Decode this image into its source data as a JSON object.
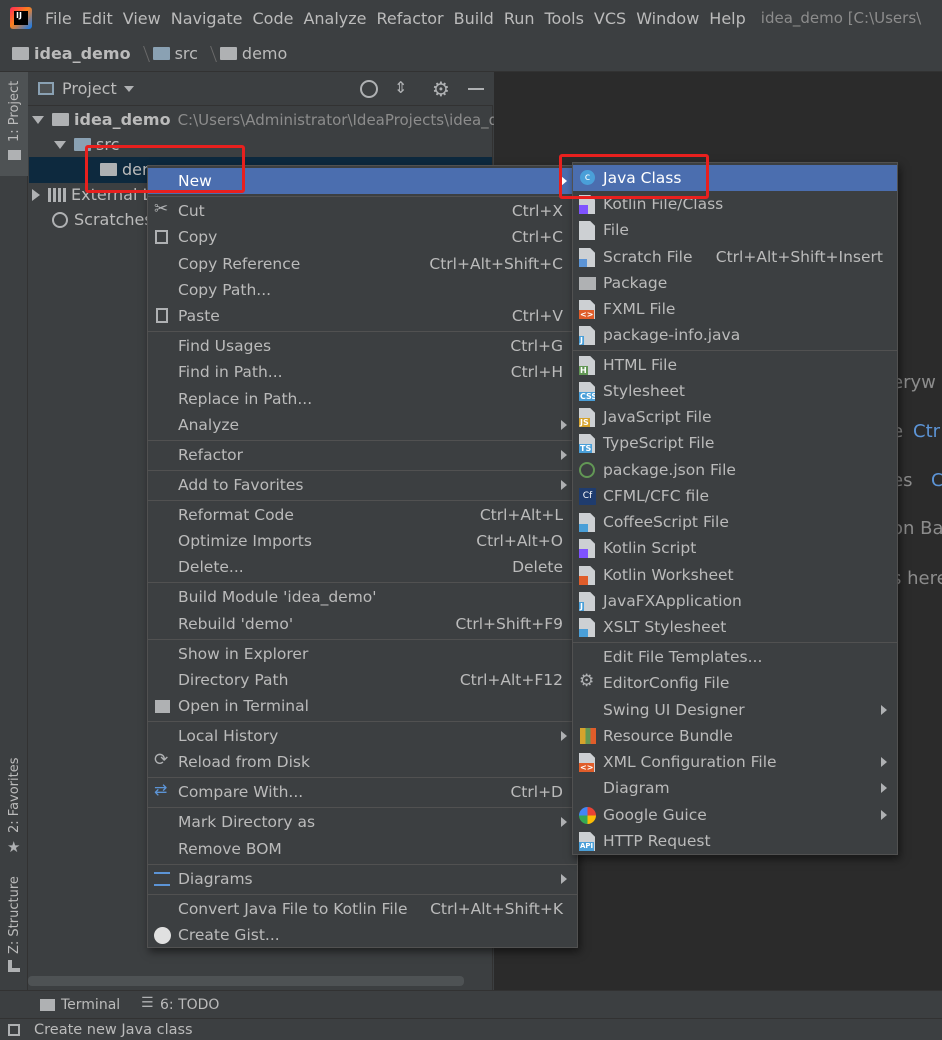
{
  "app": {
    "logo_text": "IJ",
    "window_title": "idea_demo [C:\\Users\\"
  },
  "menubar": [
    "File",
    "Edit",
    "View",
    "Navigate",
    "Code",
    "Analyze",
    "Refactor",
    "Build",
    "Run",
    "Tools",
    "VCS",
    "Window",
    "Help"
  ],
  "breadcrumb": [
    "idea_demo",
    "src",
    "demo"
  ],
  "tool_strip": {
    "project": "1: Project",
    "favorites": "2: Favorites",
    "structure": "Z: Structure"
  },
  "panel": {
    "title": "Project"
  },
  "tree": {
    "root": "idea_demo",
    "root_path": "C:\\Users\\Administrator\\IdeaProjects\\idea_de",
    "src": "src",
    "demo": "dem",
    "external": "External L",
    "scratches": "Scratches"
  },
  "editor_hints": [
    "eryw",
    "e",
    "Ctr",
    "es",
    "C",
    "on Ba",
    "s here"
  ],
  "context_menu": {
    "new": "New",
    "items": [
      {
        "label": "Cut",
        "shortcut": "Ctrl+X"
      },
      {
        "label": "Copy",
        "shortcut": "Ctrl+C"
      },
      {
        "label": "Copy Reference",
        "shortcut": "Ctrl+Alt+Shift+C"
      },
      {
        "label": "Copy Path...",
        "shortcut": ""
      },
      {
        "label": "Paste",
        "shortcut": "Ctrl+V"
      },
      {
        "label": "Find Usages",
        "shortcut": "Ctrl+G"
      },
      {
        "label": "Find in Path...",
        "shortcut": "Ctrl+H"
      },
      {
        "label": "Replace in Path...",
        "shortcut": ""
      },
      {
        "label": "Analyze",
        "shortcut": ""
      },
      {
        "label": "Refactor",
        "shortcut": ""
      },
      {
        "label": "Add to Favorites",
        "shortcut": ""
      },
      {
        "label": "Reformat Code",
        "shortcut": "Ctrl+Alt+L"
      },
      {
        "label": "Optimize Imports",
        "shortcut": "Ctrl+Alt+O"
      },
      {
        "label": "Delete...",
        "shortcut": "Delete"
      },
      {
        "label": "Build Module 'idea_demo'",
        "shortcut": ""
      },
      {
        "label": "Rebuild 'demo'",
        "shortcut": "Ctrl+Shift+F9"
      },
      {
        "label": "Show in Explorer",
        "shortcut": ""
      },
      {
        "label": "Directory Path",
        "shortcut": "Ctrl+Alt+F12"
      },
      {
        "label": "Open in Terminal",
        "shortcut": ""
      },
      {
        "label": "Local History",
        "shortcut": ""
      },
      {
        "label": "Reload from Disk",
        "shortcut": ""
      },
      {
        "label": "Compare With...",
        "shortcut": "Ctrl+D"
      },
      {
        "label": "Mark Directory as",
        "shortcut": ""
      },
      {
        "label": "Remove BOM",
        "shortcut": ""
      },
      {
        "label": "Diagrams",
        "shortcut": ""
      },
      {
        "label": "Convert Java File to Kotlin File",
        "shortcut": "Ctrl+Alt+Shift+K"
      },
      {
        "label": "Create Gist...",
        "shortcut": ""
      }
    ]
  },
  "new_submenu": [
    {
      "label": "Java Class",
      "shortcut": ""
    },
    {
      "label": "Kotlin File/Class",
      "shortcut": ""
    },
    {
      "label": "File",
      "shortcut": ""
    },
    {
      "label": "Scratch File",
      "shortcut": "Ctrl+Alt+Shift+Insert"
    },
    {
      "label": "Package",
      "shortcut": ""
    },
    {
      "label": "FXML File",
      "shortcut": ""
    },
    {
      "label": "package-info.java",
      "shortcut": ""
    },
    {
      "label": "HTML File",
      "shortcut": ""
    },
    {
      "label": "Stylesheet",
      "shortcut": ""
    },
    {
      "label": "JavaScript File",
      "shortcut": ""
    },
    {
      "label": "TypeScript File",
      "shortcut": ""
    },
    {
      "label": "package.json File",
      "shortcut": ""
    },
    {
      "label": "CFML/CFC file",
      "shortcut": ""
    },
    {
      "label": "CoffeeScript File",
      "shortcut": ""
    },
    {
      "label": "Kotlin Script",
      "shortcut": ""
    },
    {
      "label": "Kotlin Worksheet",
      "shortcut": ""
    },
    {
      "label": "JavaFXApplication",
      "shortcut": ""
    },
    {
      "label": "XSLT Stylesheet",
      "shortcut": ""
    },
    {
      "label": "Edit File Templates...",
      "shortcut": ""
    },
    {
      "label": "EditorConfig File",
      "shortcut": ""
    },
    {
      "label": "Swing UI Designer",
      "shortcut": ""
    },
    {
      "label": "Resource Bundle",
      "shortcut": ""
    },
    {
      "label": "XML Configuration File",
      "shortcut": ""
    },
    {
      "label": "Diagram",
      "shortcut": ""
    },
    {
      "label": "Google Guice",
      "shortcut": ""
    },
    {
      "label": "HTTP Request",
      "shortcut": ""
    }
  ],
  "icon_badges": {
    "css": "CSS",
    "js": "JS",
    "ts": "TS",
    "html": "H",
    "cf": "Cf",
    "api": "API",
    "java": "J",
    "xml": "<>",
    "fxml": "<>",
    "c": "c"
  },
  "bottom_tools": {
    "terminal": "Terminal",
    "todo": "6: TODO"
  },
  "status": "Create new Java class",
  "colors": {
    "selection": "#4b6eaf",
    "highlight_box": "#e8201e",
    "editor_bg": "#2b2b2b",
    "panel_bg": "#3c3f41"
  }
}
